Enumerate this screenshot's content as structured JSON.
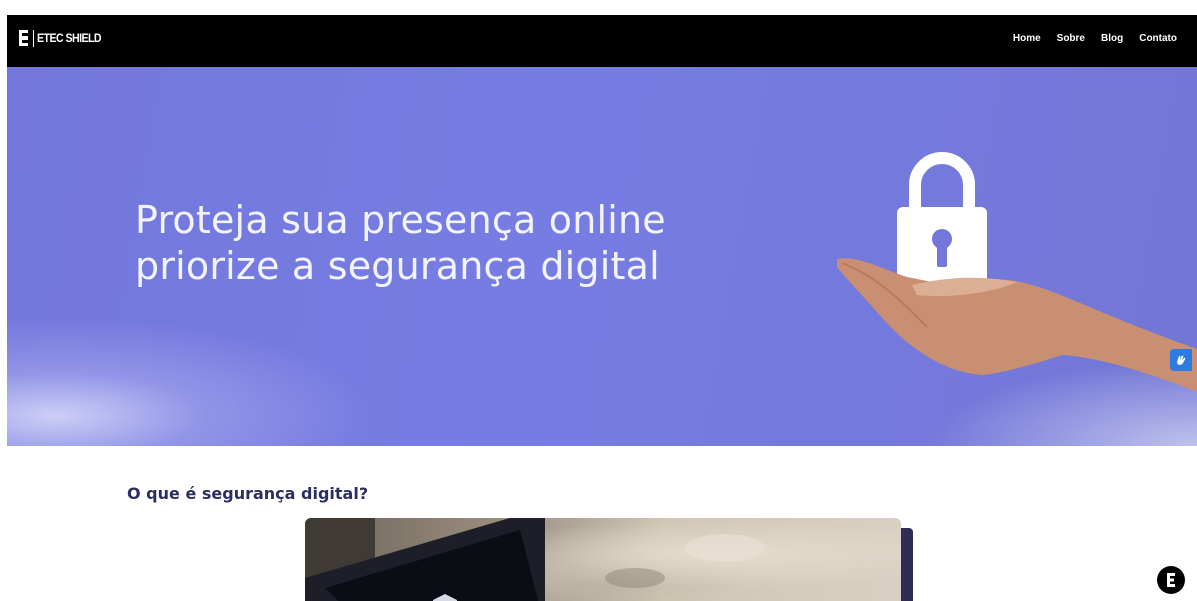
{
  "nav": {
    "brand": "ETEC SHIELD",
    "links": [
      "Home",
      "Sobre",
      "Blog",
      "Contato"
    ]
  },
  "hero": {
    "line1": "Proteja sua presença online",
    "line2": "priorize a segurança digital"
  },
  "section": {
    "title": "O que é segurança digital?"
  },
  "icons": {
    "brand_logo": "e-logo-icon",
    "hero_art": "lock-on-hand-icon",
    "accessibility": "sign-language-icon",
    "chat": "e-logo-icon"
  },
  "colors": {
    "navbar": "#000000",
    "hero_background": "#767de2",
    "hero_text": "#f3f3fb",
    "section_title": "#2b2f5e",
    "accessibility_button": "#2d7be0"
  }
}
